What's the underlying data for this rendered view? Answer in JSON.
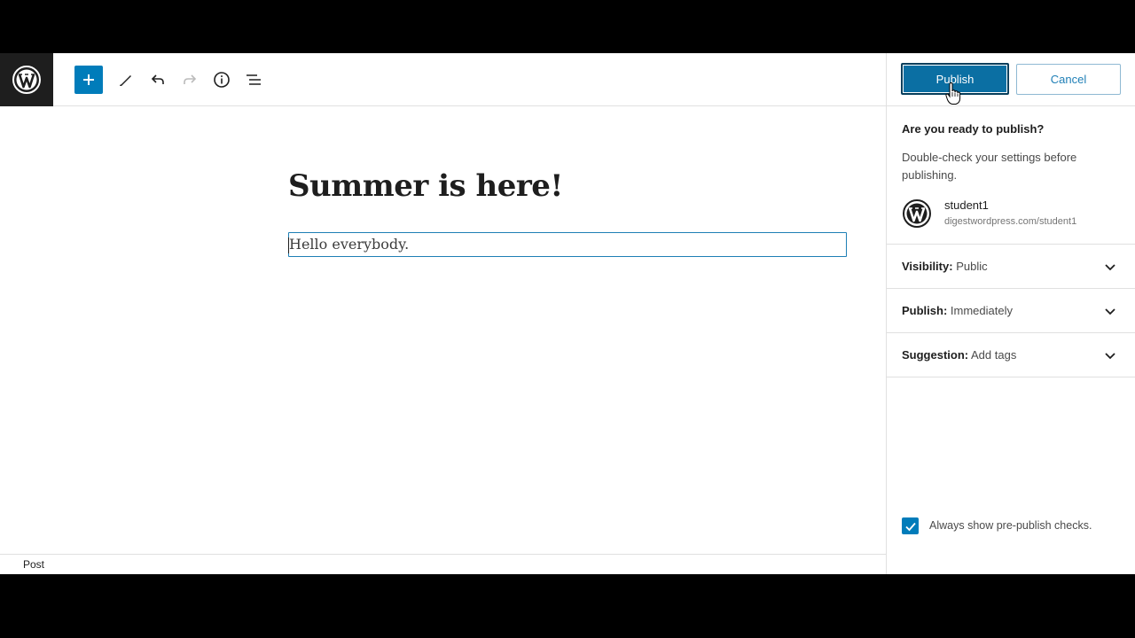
{
  "toolbar": {
    "logo_icon": "wordpress-icon",
    "add_block_icon": "plus-icon",
    "tools_icon": "pencil-icon",
    "undo_icon": "undo-icon",
    "redo_icon": "redo-icon",
    "details_icon": "info-icon",
    "outline_icon": "list-view-icon"
  },
  "editor": {
    "title": "Summer is here!",
    "paragraph": "Hello everybody.",
    "footer_breadcrumb": "Post"
  },
  "sidebar": {
    "publish_label": "Publish",
    "cancel_label": "Cancel",
    "prepublish_title": "Are you ready to publish?",
    "prepublish_desc": "Double-check your settings before publishing.",
    "site_name": "student1",
    "site_url": "digestwordpress.com/student1",
    "panels": [
      {
        "label": "Visibility:",
        "value": "Public"
      },
      {
        "label": "Publish:",
        "value": "Immediately"
      },
      {
        "label": "Suggestion:",
        "value": "Add tags"
      }
    ],
    "checkbox_label": "Always show pre-publish checks.",
    "checkbox_checked": true
  },
  "colors": {
    "accent": "#007cba",
    "publish_button": "#0b6fa3",
    "dark": "#1e1e1e"
  }
}
